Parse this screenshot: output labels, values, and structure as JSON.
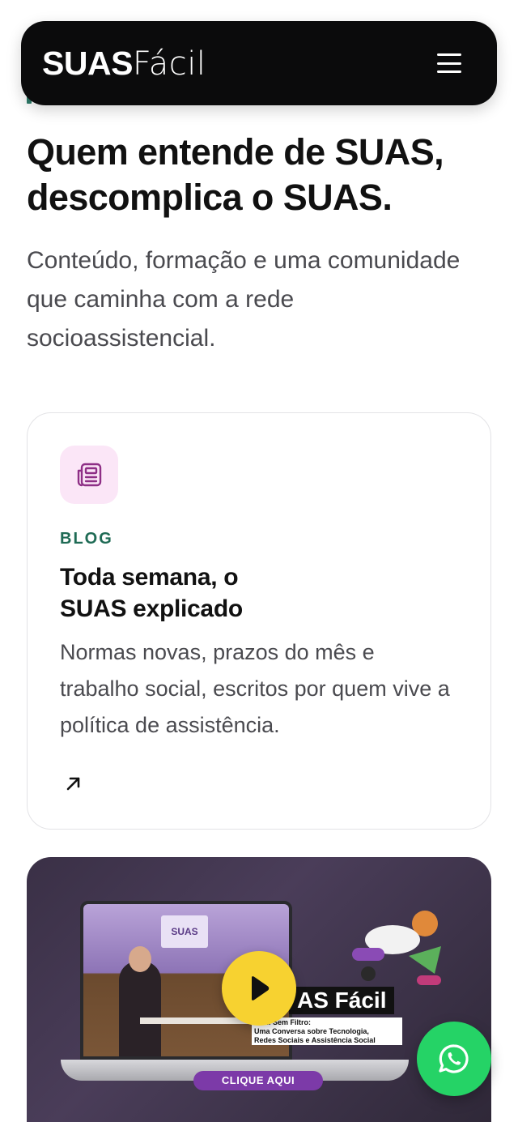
{
  "header": {
    "brand_strong": "SUAS",
    "brand_light": "Fácil",
    "menu_icon": "hamburger-menu-icon",
    "background": "#0b0b0c"
  },
  "hero": {
    "title_line1": "Quem entende de SUAS,",
    "title_line2": "descomplica o SUAS.",
    "subtitle": "Conteúdo, formação e uma comunidade que caminha com a rede socioassistencial."
  },
  "blog_card": {
    "icon": "newspaper-icon",
    "kicker": "BLOG",
    "title_line1": "Toda semana, o",
    "title_line2": "SUAS explicado",
    "text": "Normas novas, prazos do mês e trabalho social, escritos por quem vive a política de assistência.",
    "arrow_icon": "arrow-up-right-icon",
    "icon_bg": "#fbe6f7",
    "kicker_color": "#1f6b55"
  },
  "video": {
    "studio_sign": "SUAS",
    "brand_tag": "AS Fácil",
    "episode_line1": "Fácil Sem Filtro:",
    "episode_line2": "Uma Conversa sobre Tecnologia,",
    "episode_line3": "Redes Sociais e Assistência Social",
    "cta_label": "CLIQUE AQUI",
    "play_icon": "play-icon",
    "play_color": "#f7d230"
  },
  "whatsapp": {
    "icon": "whatsapp-icon",
    "color": "#25d366"
  }
}
